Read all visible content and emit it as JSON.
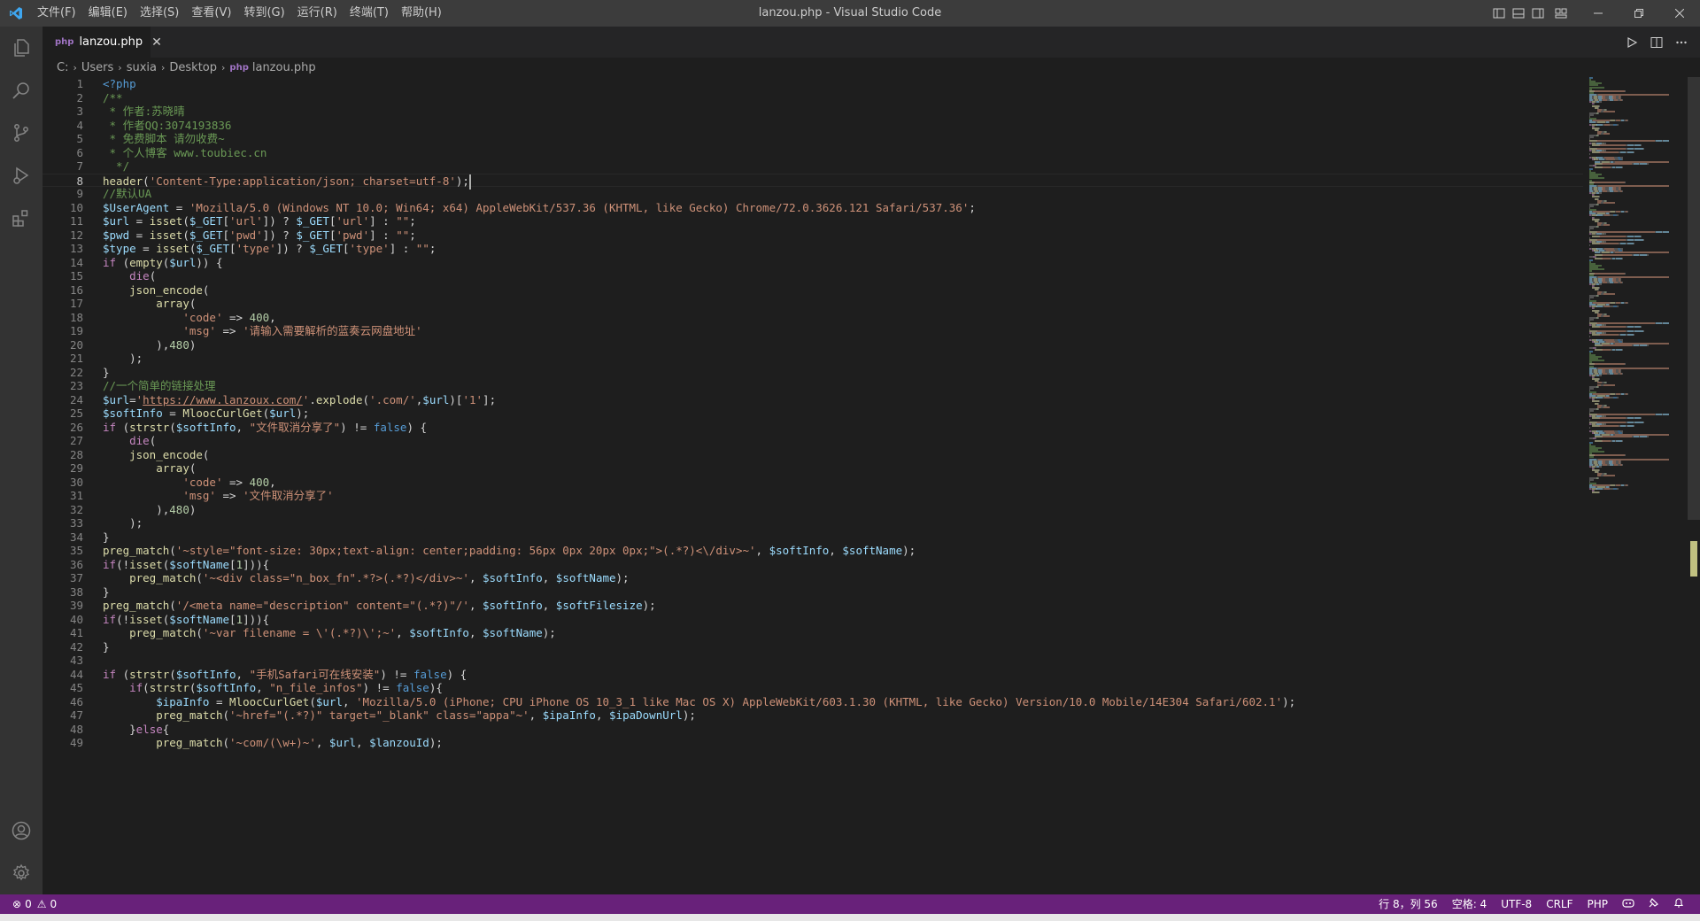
{
  "window": {
    "title": "lanzou.php - Visual Studio Code",
    "menu": [
      "文件(F)",
      "编辑(E)",
      "选择(S)",
      "查看(V)",
      "转到(G)",
      "运行(R)",
      "终端(T)",
      "帮助(H)"
    ]
  },
  "icons": {
    "app": "vscode-logo-icon",
    "activity": [
      "files-icon",
      "search-icon",
      "source-control-icon",
      "run-debug-icon",
      "extensions-icon",
      "account-icon",
      "gear-icon"
    ]
  },
  "colors": {
    "status_bar": "#68217a",
    "php_file_icon": "#a074c4"
  },
  "tab": {
    "label": "lanzou.php",
    "icon_text": "php"
  },
  "breadcrumb": [
    "C:",
    "Users",
    "suxia",
    "Desktop",
    "lanzou.php"
  ],
  "editor": {
    "active_line": 8,
    "lines": [
      [
        [
          "t-tag",
          "<?php"
        ]
      ],
      [
        [
          "t-com",
          "/**"
        ]
      ],
      [
        [
          "t-com",
          " * 作者:苏晓晴"
        ]
      ],
      [
        [
          "t-com",
          " * 作者QQ:3074193836"
        ]
      ],
      [
        [
          "t-com",
          " * 免费脚本 请勿收费~"
        ]
      ],
      [
        [
          "t-com",
          " * 个人博客 www.toubiec.cn"
        ]
      ],
      [
        [
          "t-com",
          "  */"
        ]
      ],
      [
        [
          "t-fn",
          "header"
        ],
        [
          "t-pl",
          "("
        ],
        [
          "t-str",
          "'Content-Type:application/json; charset=utf-8'"
        ],
        [
          "t-pl",
          ");"
        ]
      ],
      [
        [
          "t-com",
          "//默认UA"
        ]
      ],
      [
        [
          "t-var",
          "$UserAgent"
        ],
        [
          "t-pl",
          " = "
        ],
        [
          "t-str",
          "'Mozilla/5.0 (Windows NT 10.0; Win64; x64) AppleWebKit/537.36 (KHTML, like Gecko) Chrome/72.0.3626.121 Safari/537.36'"
        ],
        [
          "t-pl",
          ";"
        ]
      ],
      [
        [
          "t-var",
          "$url"
        ],
        [
          "t-pl",
          " = "
        ],
        [
          "t-fn",
          "isset"
        ],
        [
          "t-pl",
          "("
        ],
        [
          "t-var",
          "$_GET"
        ],
        [
          "t-pl",
          "["
        ],
        [
          "t-str",
          "'url'"
        ],
        [
          "t-pl",
          "]) ? "
        ],
        [
          "t-var",
          "$_GET"
        ],
        [
          "t-pl",
          "["
        ],
        [
          "t-str",
          "'url'"
        ],
        [
          "t-pl",
          "] : "
        ],
        [
          "t-str",
          "\"\""
        ],
        [
          "t-pl",
          ";"
        ]
      ],
      [
        [
          "t-var",
          "$pwd"
        ],
        [
          "t-pl",
          " = "
        ],
        [
          "t-fn",
          "isset"
        ],
        [
          "t-pl",
          "("
        ],
        [
          "t-var",
          "$_GET"
        ],
        [
          "t-pl",
          "["
        ],
        [
          "t-str",
          "'pwd'"
        ],
        [
          "t-pl",
          "]) ? "
        ],
        [
          "t-var",
          "$_GET"
        ],
        [
          "t-pl",
          "["
        ],
        [
          "t-str",
          "'pwd'"
        ],
        [
          "t-pl",
          "] : "
        ],
        [
          "t-str",
          "\"\""
        ],
        [
          "t-pl",
          ";"
        ]
      ],
      [
        [
          "t-var",
          "$type"
        ],
        [
          "t-pl",
          " = "
        ],
        [
          "t-fn",
          "isset"
        ],
        [
          "t-pl",
          "("
        ],
        [
          "t-var",
          "$_GET"
        ],
        [
          "t-pl",
          "["
        ],
        [
          "t-str",
          "'type'"
        ],
        [
          "t-pl",
          "]) ? "
        ],
        [
          "t-var",
          "$_GET"
        ],
        [
          "t-pl",
          "["
        ],
        [
          "t-str",
          "'type'"
        ],
        [
          "t-pl",
          "] : "
        ],
        [
          "t-str",
          "\"\""
        ],
        [
          "t-pl",
          ";"
        ]
      ],
      [
        [
          "t-kw",
          "if"
        ],
        [
          "t-pl",
          " ("
        ],
        [
          "t-fn",
          "empty"
        ],
        [
          "t-pl",
          "("
        ],
        [
          "t-var",
          "$url"
        ],
        [
          "t-pl",
          ")) {"
        ]
      ],
      [
        [
          "t-pl",
          "    "
        ],
        [
          "t-kw",
          "die"
        ],
        [
          "t-pl",
          "("
        ]
      ],
      [
        [
          "t-pl",
          "    "
        ],
        [
          "t-fn",
          "json_encode"
        ],
        [
          "t-pl",
          "("
        ]
      ],
      [
        [
          "t-pl",
          "        "
        ],
        [
          "t-fn",
          "array"
        ],
        [
          "t-pl",
          "("
        ]
      ],
      [
        [
          "t-pl",
          "            "
        ],
        [
          "t-str",
          "'code'"
        ],
        [
          "t-pl",
          " => "
        ],
        [
          "t-num",
          "400"
        ],
        [
          "t-pl",
          ","
        ]
      ],
      [
        [
          "t-pl",
          "            "
        ],
        [
          "t-str",
          "'msg'"
        ],
        [
          "t-pl",
          " => "
        ],
        [
          "t-str",
          "'请输入需要解析的蓝奏云网盘地址'"
        ]
      ],
      [
        [
          "t-pl",
          "        ),"
        ],
        [
          "t-num",
          "480"
        ],
        [
          "t-pl",
          ")"
        ]
      ],
      [
        [
          "t-pl",
          "    );"
        ]
      ],
      [
        [
          "t-pl",
          "}"
        ]
      ],
      [
        [
          "t-com",
          "//一个简单的链接处理"
        ]
      ],
      [
        [
          "t-var",
          "$url"
        ],
        [
          "t-pl",
          "="
        ],
        [
          "t-str",
          "'"
        ],
        [
          "t-url",
          "https://www.lanzoux.com/"
        ],
        [
          "t-str",
          "'"
        ],
        [
          "t-pl",
          "."
        ],
        [
          "t-fn",
          "explode"
        ],
        [
          "t-pl",
          "("
        ],
        [
          "t-str",
          "'.com/'"
        ],
        [
          "t-pl",
          ","
        ],
        [
          "t-var",
          "$url"
        ],
        [
          "t-pl",
          ")["
        ],
        [
          "t-str",
          "'1'"
        ],
        [
          "t-pl",
          "];"
        ]
      ],
      [
        [
          "t-var",
          "$softInfo"
        ],
        [
          "t-pl",
          " = "
        ],
        [
          "t-fn",
          "MloocCurlGet"
        ],
        [
          "t-pl",
          "("
        ],
        [
          "t-var",
          "$url"
        ],
        [
          "t-pl",
          ");"
        ]
      ],
      [
        [
          "t-kw",
          "if"
        ],
        [
          "t-pl",
          " ("
        ],
        [
          "t-fn",
          "strstr"
        ],
        [
          "t-pl",
          "("
        ],
        [
          "t-var",
          "$softInfo"
        ],
        [
          "t-pl",
          ", "
        ],
        [
          "t-str",
          "\"文件取消分享了\""
        ],
        [
          "t-pl",
          ") != "
        ],
        [
          "t-const",
          "false"
        ],
        [
          "t-pl",
          ") {"
        ]
      ],
      [
        [
          "t-pl",
          "    "
        ],
        [
          "t-kw",
          "die"
        ],
        [
          "t-pl",
          "("
        ]
      ],
      [
        [
          "t-pl",
          "    "
        ],
        [
          "t-fn",
          "json_encode"
        ],
        [
          "t-pl",
          "("
        ]
      ],
      [
        [
          "t-pl",
          "        "
        ],
        [
          "t-fn",
          "array"
        ],
        [
          "t-pl",
          "("
        ]
      ],
      [
        [
          "t-pl",
          "            "
        ],
        [
          "t-str",
          "'code'"
        ],
        [
          "t-pl",
          " => "
        ],
        [
          "t-num",
          "400"
        ],
        [
          "t-pl",
          ","
        ]
      ],
      [
        [
          "t-pl",
          "            "
        ],
        [
          "t-str",
          "'msg'"
        ],
        [
          "t-pl",
          " => "
        ],
        [
          "t-str",
          "'文件取消分享了'"
        ]
      ],
      [
        [
          "t-pl",
          "        ),"
        ],
        [
          "t-num",
          "480"
        ],
        [
          "t-pl",
          ")"
        ]
      ],
      [
        [
          "t-pl",
          "    );"
        ]
      ],
      [
        [
          "t-pl",
          "}"
        ]
      ],
      [
        [
          "t-fn",
          "preg_match"
        ],
        [
          "t-pl",
          "("
        ],
        [
          "t-str",
          "'~style=\"font-size: 30px;text-align: center;padding: 56px 0px 20px 0px;\">(.*?)<\\/div>~'"
        ],
        [
          "t-pl",
          ", "
        ],
        [
          "t-var",
          "$softInfo"
        ],
        [
          "t-pl",
          ", "
        ],
        [
          "t-var",
          "$softName"
        ],
        [
          "t-pl",
          ");"
        ]
      ],
      [
        [
          "t-kw",
          "if"
        ],
        [
          "t-pl",
          "(!"
        ],
        [
          "t-fn",
          "isset"
        ],
        [
          "t-pl",
          "("
        ],
        [
          "t-var",
          "$softName"
        ],
        [
          "t-pl",
          "["
        ],
        [
          "t-num",
          "1"
        ],
        [
          "t-pl",
          "])){"
        ]
      ],
      [
        [
          "t-pl",
          "    "
        ],
        [
          "t-fn",
          "preg_match"
        ],
        [
          "t-pl",
          "("
        ],
        [
          "t-str",
          "'~<div class=\"n_box_fn\".*?>(.*?)</div>~'"
        ],
        [
          "t-pl",
          ", "
        ],
        [
          "t-var",
          "$softInfo"
        ],
        [
          "t-pl",
          ", "
        ],
        [
          "t-var",
          "$softName"
        ],
        [
          "t-pl",
          ");"
        ]
      ],
      [
        [
          "t-pl",
          "}"
        ]
      ],
      [
        [
          "t-fn",
          "preg_match"
        ],
        [
          "t-pl",
          "("
        ],
        [
          "t-str",
          "'/<meta name=\"description\" content=\"(.*?)\"/'"
        ],
        [
          "t-pl",
          ", "
        ],
        [
          "t-var",
          "$softInfo"
        ],
        [
          "t-pl",
          ", "
        ],
        [
          "t-var",
          "$softFilesize"
        ],
        [
          "t-pl",
          ");"
        ]
      ],
      [
        [
          "t-kw",
          "if"
        ],
        [
          "t-pl",
          "(!"
        ],
        [
          "t-fn",
          "isset"
        ],
        [
          "t-pl",
          "("
        ],
        [
          "t-var",
          "$softName"
        ],
        [
          "t-pl",
          "["
        ],
        [
          "t-num",
          "1"
        ],
        [
          "t-pl",
          "])){"
        ]
      ],
      [
        [
          "t-pl",
          "    "
        ],
        [
          "t-fn",
          "preg_match"
        ],
        [
          "t-pl",
          "("
        ],
        [
          "t-str",
          "'~var filename = \\'(.*?)\\';~'"
        ],
        [
          "t-pl",
          ", "
        ],
        [
          "t-var",
          "$softInfo"
        ],
        [
          "t-pl",
          ", "
        ],
        [
          "t-var",
          "$softName"
        ],
        [
          "t-pl",
          ");"
        ]
      ],
      [
        [
          "t-pl",
          "}"
        ]
      ],
      [],
      [
        [
          "t-kw",
          "if"
        ],
        [
          "t-pl",
          " ("
        ],
        [
          "t-fn",
          "strstr"
        ],
        [
          "t-pl",
          "("
        ],
        [
          "t-var",
          "$softInfo"
        ],
        [
          "t-pl",
          ", "
        ],
        [
          "t-str",
          "\"手机Safari可在线安装\""
        ],
        [
          "t-pl",
          ") != "
        ],
        [
          "t-const",
          "false"
        ],
        [
          "t-pl",
          ") {"
        ]
      ],
      [
        [
          "t-pl",
          "    "
        ],
        [
          "t-kw",
          "if"
        ],
        [
          "t-pl",
          "("
        ],
        [
          "t-fn",
          "strstr"
        ],
        [
          "t-pl",
          "("
        ],
        [
          "t-var",
          "$softInfo"
        ],
        [
          "t-pl",
          ", "
        ],
        [
          "t-str",
          "\"n_file_infos\""
        ],
        [
          "t-pl",
          ") != "
        ],
        [
          "t-const",
          "false"
        ],
        [
          "t-pl",
          "){"
        ]
      ],
      [
        [
          "t-pl",
          "        "
        ],
        [
          "t-var",
          "$ipaInfo"
        ],
        [
          "t-pl",
          " = "
        ],
        [
          "t-fn",
          "MloocCurlGet"
        ],
        [
          "t-pl",
          "("
        ],
        [
          "t-var",
          "$url"
        ],
        [
          "t-pl",
          ", "
        ],
        [
          "t-str",
          "'Mozilla/5.0 (iPhone; CPU iPhone OS 10_3_1 like Mac OS X) AppleWebKit/603.1.30 (KHTML, like Gecko) Version/10.0 Mobile/14E304 Safari/602.1'"
        ],
        [
          "t-pl",
          ");"
        ]
      ],
      [
        [
          "t-pl",
          "        "
        ],
        [
          "t-fn",
          "preg_match"
        ],
        [
          "t-pl",
          "("
        ],
        [
          "t-str",
          "'~href=\"(.*?)\" target=\"_blank\" class=\"appa\"~'"
        ],
        [
          "t-pl",
          ", "
        ],
        [
          "t-var",
          "$ipaInfo"
        ],
        [
          "t-pl",
          ", "
        ],
        [
          "t-var",
          "$ipaDownUrl"
        ],
        [
          "t-pl",
          ");"
        ]
      ],
      [
        [
          "t-pl",
          "    }"
        ],
        [
          "t-kw",
          "else"
        ],
        [
          "t-pl",
          "{"
        ]
      ],
      [
        [
          "t-pl",
          "        "
        ],
        [
          "t-fn",
          "preg_match"
        ],
        [
          "t-pl",
          "("
        ],
        [
          "t-str",
          "'~com/(\\w+)~'"
        ],
        [
          "t-pl",
          ", "
        ],
        [
          "t-var",
          "$url"
        ],
        [
          "t-pl",
          ", "
        ],
        [
          "t-var",
          "$lanzouId"
        ],
        [
          "t-pl",
          ");"
        ]
      ]
    ]
  },
  "status": {
    "errors": "0",
    "warnings": "0",
    "position": "行 8，列 56",
    "spaces": "空格: 4",
    "encoding": "UTF-8",
    "eol": "CRLF",
    "language": "PHP"
  }
}
